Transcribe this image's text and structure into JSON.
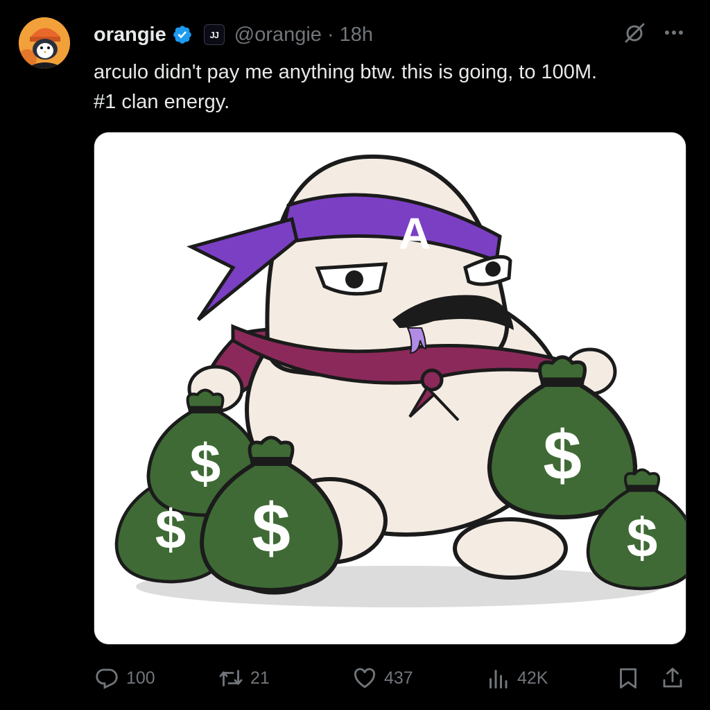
{
  "post": {
    "author_name": "orangie",
    "handle": "@orangie",
    "separator": "·",
    "time": "18h",
    "affiliate_badge": "JJ",
    "text_lines": [
      "arculo didn't pay me anything btw. this is going, to 100M.",
      "#1 clan energy."
    ],
    "image": {
      "headband_letter": "A",
      "bag_symbol": "$"
    }
  },
  "actions": {
    "replies": "100",
    "reposts": "21",
    "likes": "437",
    "views": "42K"
  },
  "colors": {
    "background": "#000000",
    "text": "#e7e9ea",
    "muted": "#71767b",
    "verified_blue": "#1d9bf0",
    "headband_purple": "#7b3fc4",
    "cape_maroon": "#8b2a5a",
    "bag_green": "#3f6a35"
  },
  "icons": [
    "verified-badge-icon",
    "grok-icon",
    "more-icon",
    "reply-icon",
    "repost-icon",
    "like-icon",
    "views-icon",
    "bookmark-icon",
    "share-icon"
  ]
}
